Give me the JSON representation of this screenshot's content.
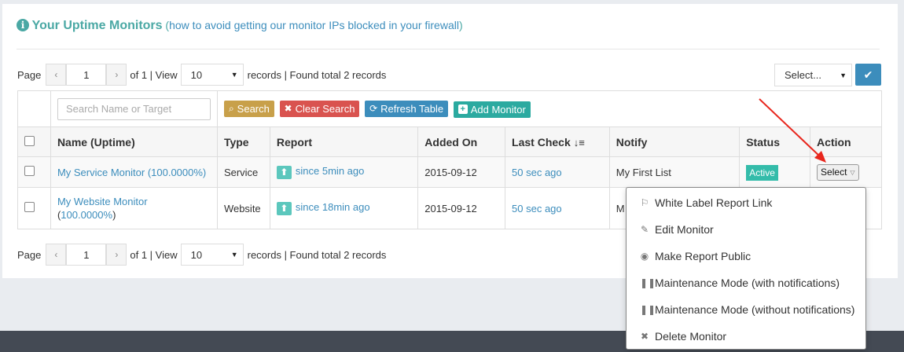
{
  "header": {
    "info_glyph": "i",
    "title": "Your Uptime Monitors",
    "paren_open": " (",
    "link": "how to avoid getting our monitor IPs blocked in your firewall",
    "paren_close": ")"
  },
  "pager_top": {
    "page_label": "Page",
    "prev": "‹",
    "page": "1",
    "next": "›",
    "of_label": "of 1 | View",
    "view": "10",
    "records_label": "records | Found total 2 records"
  },
  "pager_bottom": {
    "page_label": "Page",
    "prev": "‹",
    "page": "1",
    "next": "›",
    "of_label": "of 1 | View",
    "view": "10",
    "records_label": "records | Found total 2 records"
  },
  "bulk": {
    "select": "Select...",
    "ok_icon": "✔"
  },
  "search": {
    "placeholder": "Search Name or Target",
    "search_btn": "Search",
    "clear_btn": "Clear Search",
    "refresh_btn": "Refresh Table",
    "add_btn": "Add Monitor"
  },
  "columns": [
    "Name (Uptime)",
    "Type",
    "Report",
    "Added On",
    "Last Check",
    "Notify",
    "Status",
    "Action"
  ],
  "rows": [
    {
      "name": "My Service Monitor",
      "uptime": "(100.0000%)",
      "type": "Service",
      "report": "since 5min ago",
      "added": "2015-09-12",
      "last_check": "50 sec ago",
      "notify": "My First List",
      "status": "Active",
      "action": "Select"
    },
    {
      "name": "My Website Monitor",
      "uptime": "(100.0000%)",
      "type": "Website",
      "report": "since 18min ago",
      "added": "2015-09-12",
      "last_check": "50 sec ago",
      "notify": "M",
      "status": "",
      "action": ""
    }
  ],
  "action_menu": [
    {
      "icon": "bookmark-icon",
      "glyph": "⚐",
      "label": "White Label Report Link"
    },
    {
      "icon": "pencil-icon",
      "glyph": "✎",
      "label": "Edit Monitor"
    },
    {
      "icon": "eye-icon",
      "glyph": "◉",
      "label": "Make Report Public"
    },
    {
      "icon": "pause-icon",
      "glyph": "❚❚",
      "label": "Maintenance Mode (with notifications)"
    },
    {
      "icon": "pause-icon",
      "glyph": "❚❚",
      "label": "Maintenance Mode (without notifications)"
    },
    {
      "icon": "close-icon",
      "glyph": "✖",
      "label": "Delete Monitor"
    }
  ],
  "colors": {
    "accent": "#4aa8a4",
    "link": "#3c8dbc",
    "danger": "#d9534f",
    "warning": "#c8a04a",
    "success": "#34bcaa",
    "annotation": "#e8261d"
  }
}
